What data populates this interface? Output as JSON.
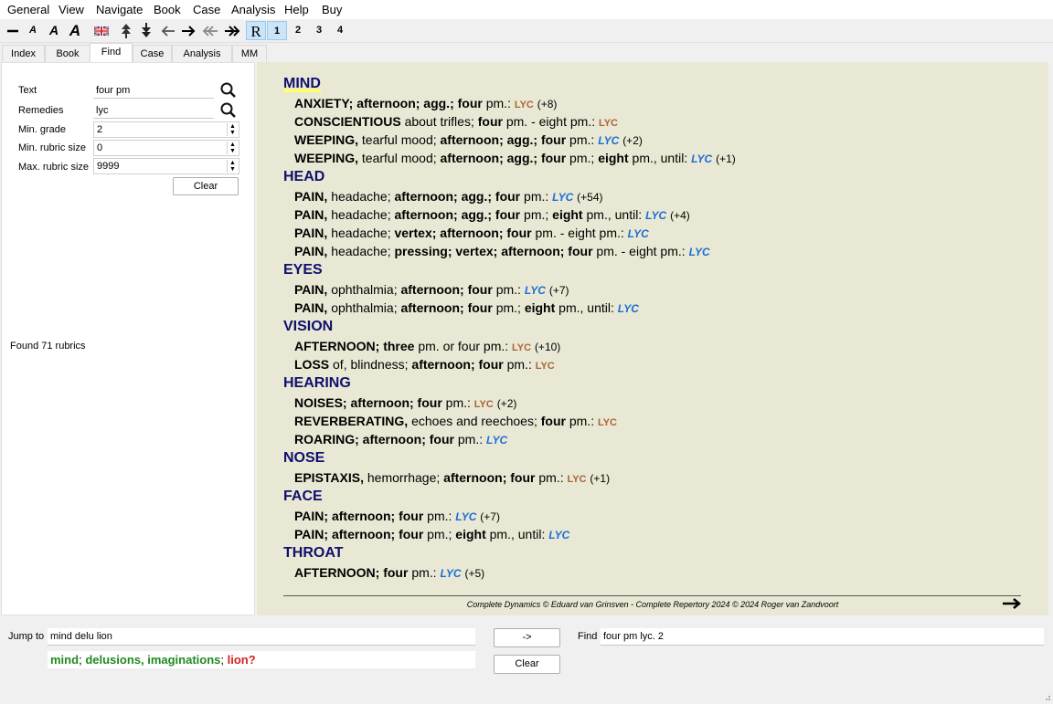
{
  "menu": [
    "General",
    "View",
    "Navigate",
    "Book",
    "Case",
    "Analysis",
    "Help",
    "Buy"
  ],
  "toolbar": {
    "r": "R",
    "n1": "1",
    "n2": "2",
    "n3": "3",
    "n4": "4",
    "font_a": "A"
  },
  "tabs": [
    "Index",
    "Book",
    "Find",
    "Case",
    "Analysis",
    "MM"
  ],
  "find_form": {
    "text_label": "Text",
    "text_value": "four pm",
    "remedies_label": "Remedies",
    "remedies_value": "lyc",
    "min_grade_label": "Min. grade",
    "min_grade_value": "2",
    "min_rubric_label": "Min. rubric size",
    "min_rubric_value": "0",
    "max_rubric_label": "Max. rubric size",
    "max_rubric_value": "9999",
    "clear_label": "Clear",
    "found_text": "Found 71 rubrics"
  },
  "results": {
    "chapters": {
      "mind": "MIND",
      "head": "HEAD",
      "eyes": "EYES",
      "vision": "VISION",
      "hearing": "HEARING",
      "nose": "NOSE",
      "face": "FACE",
      "throat": "THROAT"
    },
    "remedy": "LYC",
    "footer": "Complete Dynamics © Eduard van Grinsven   -   Complete Repertory 2024 © 2024 Roger van Zandvoort"
  },
  "bottom": {
    "jump_label": "Jump to",
    "jump_value": "mind delu lion",
    "go_label": "->",
    "clear_label": "Clear",
    "find_label": "Find",
    "find_value": "four pm lyc. 2",
    "sugg_mind": "mind",
    "sugg_sep1": ";",
    "sugg_delusions": "delusions, imaginations",
    "sugg_sep2": ";",
    "sugg_lion": "lion?"
  }
}
